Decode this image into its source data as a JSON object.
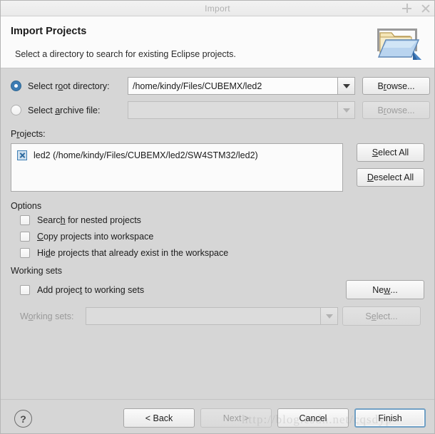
{
  "window": {
    "title": "Import",
    "controls": {
      "maximize": "maximize-icon",
      "close": "close-icon"
    }
  },
  "header": {
    "title": "Import Projects",
    "description": "Select a directory to search for existing Eclipse projects.",
    "icon": "import-folder-icon"
  },
  "source": {
    "root_directory": {
      "label_pre": "Select r",
      "label_mnemonic": "o",
      "label_post": "ot directory:",
      "selected": true,
      "value": "/home/kindy/Files/CUBEMX/led2",
      "browse_pre": "B",
      "browse_mnemonic": "r",
      "browse_post": "owse..."
    },
    "archive_file": {
      "label_pre": "Select ",
      "label_mnemonic": "a",
      "label_post": "rchive file:",
      "selected": false,
      "value": "",
      "browse_pre": "B",
      "browse_mnemonic": "r",
      "browse_post": "owse..."
    }
  },
  "projects": {
    "label_pre": "P",
    "label_mnemonic": "r",
    "label_post": "ojects:",
    "items": [
      {
        "label": "led2 (/home/kindy/Files/CUBEMX/led2/SW4STM32/led2)",
        "checked": true
      }
    ],
    "select_all": {
      "pre": "",
      "mnemonic": "S",
      "post": "elect All"
    },
    "deselect_all": {
      "pre": "",
      "mnemonic": "D",
      "post": "eselect All"
    }
  },
  "options": {
    "title": "Options",
    "items": [
      {
        "pre": "Searc",
        "mnemonic": "h",
        "post": " for nested projects",
        "checked": false
      },
      {
        "pre": "",
        "mnemonic": "C",
        "post": "opy projects into workspace",
        "checked": false
      },
      {
        "pre": "Hi",
        "mnemonic": "d",
        "post": "e projects that already exist in the workspace",
        "checked": false
      }
    ]
  },
  "working_sets": {
    "title": "Working sets",
    "add_checkbox": {
      "pre": "Add projec",
      "mnemonic": "t",
      "post": " to working sets",
      "checked": false
    },
    "new_button": {
      "pre": "Ne",
      "mnemonic": "w",
      "post": "..."
    },
    "combo_label_pre": "W",
    "combo_label_mnemonic": "o",
    "combo_label_post": "rking sets:",
    "combo_value": "",
    "select_button": {
      "pre": "S",
      "mnemonic": "e",
      "post": "lect..."
    }
  },
  "footer": {
    "help": "?",
    "back": "< Back",
    "next": "Next >",
    "cancel": "Cancel",
    "finish": "Finish"
  },
  "watermark": "http://blog.csdn.net/cqsdyp"
}
